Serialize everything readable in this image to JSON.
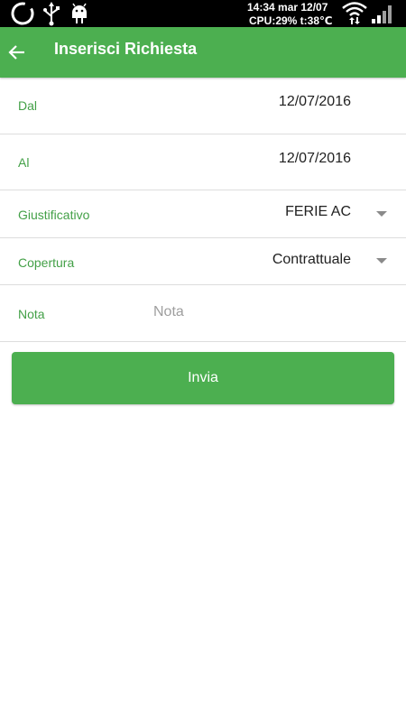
{
  "status_bar": {
    "time_date": "14:34 mar 12/07",
    "cpu_temp": "CPU:29% t:38℃",
    "icons": [
      "loading-ring-icon",
      "usb-icon",
      "android-icon",
      "wifi-icon",
      "signal-icon"
    ]
  },
  "app_bar": {
    "title": "Inserisci Richiesta",
    "back_icon": "arrow-back-icon",
    "color": "#4caf50"
  },
  "form": {
    "dal": {
      "label": "Dal",
      "value": "12/07/2016"
    },
    "al": {
      "label": "Al",
      "value": "12/07/2016"
    },
    "giustificativo": {
      "label": "Giustificativo",
      "value": "FERIE AC"
    },
    "copertura": {
      "label": "Copertura",
      "value": "Contrattuale"
    },
    "nota": {
      "label": "Nota",
      "placeholder": "Nota",
      "value": ""
    }
  },
  "submit": {
    "label": "Invia"
  },
  "colors": {
    "primary": "#4caf50",
    "label_green": "#43a047",
    "divider": "#dddddd",
    "placeholder": "#9e9e9e"
  }
}
